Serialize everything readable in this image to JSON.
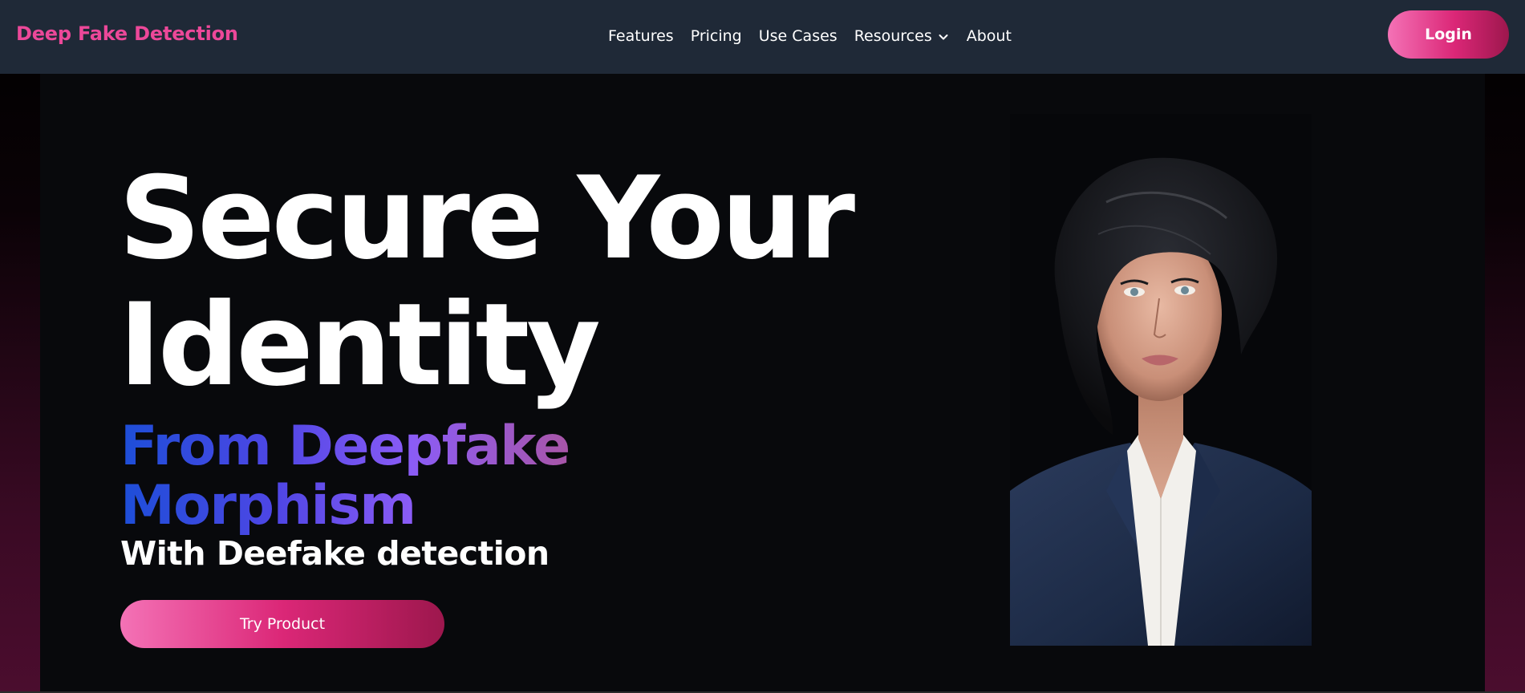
{
  "navbar": {
    "brand": "Deep Fake Detection",
    "links": [
      {
        "label": "Features"
      },
      {
        "label": "Pricing"
      },
      {
        "label": "Use Cases"
      },
      {
        "label": "Resources",
        "icon": "chevron-down-icon"
      },
      {
        "label": "About"
      }
    ],
    "login_label": "Login"
  },
  "hero": {
    "headline_line1": "Secure Your",
    "headline_line2": "Identity",
    "subhead_line1": "From Deepfake",
    "subhead_line2": "Morphism",
    "subhead2": "With Deefake detection",
    "cta_label": "Try Product"
  },
  "colors": {
    "brand": "#ec4899",
    "navbar_bg": "#1f2937",
    "hero_bg": "#08090c",
    "gradient_blue": "#1d4ed8",
    "gradient_purple": "#a855a7"
  }
}
